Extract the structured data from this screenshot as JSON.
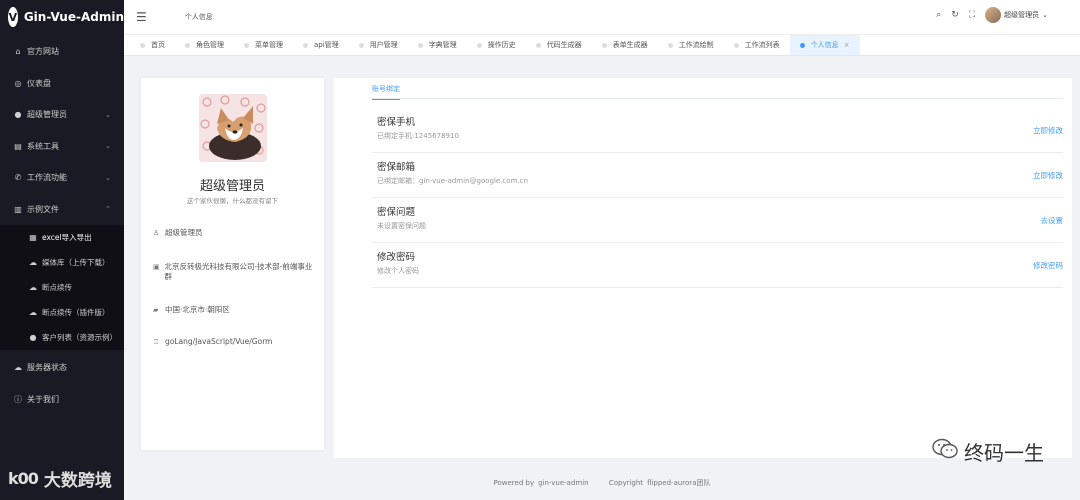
{
  "app": {
    "title": "Gin-Vue-Admin",
    "logo_letter": "V"
  },
  "sidebar": {
    "items": [
      {
        "label": "官方网站",
        "icon": "home-icon",
        "glyph": "⌂"
      },
      {
        "label": "仪表盘",
        "icon": "dashboard-icon",
        "glyph": "◎"
      },
      {
        "label": "超级管理员",
        "icon": "user-icon",
        "glyph": "●",
        "arrow": "⌄"
      },
      {
        "label": "系统工具",
        "icon": "toolbox-icon",
        "glyph": "▤",
        "arrow": "⌄"
      },
      {
        "label": "工作流功能",
        "icon": "phone-icon",
        "glyph": "✆",
        "arrow": "⌄"
      },
      {
        "label": "示例文件",
        "icon": "folder-icon",
        "glyph": "▥",
        "arrow": "⌃"
      }
    ],
    "sub_items": [
      {
        "label": "excel导入导出",
        "icon": "excel-icon",
        "glyph": "▦"
      },
      {
        "label": "媒体库（上传下载）",
        "icon": "upload-icon",
        "glyph": "☁"
      },
      {
        "label": "断点续传",
        "icon": "resume-upload-icon",
        "glyph": "☁"
      },
      {
        "label": "断点续传（插件版）",
        "icon": "plugin-upload-icon",
        "glyph": "☁"
      },
      {
        "label": "客户列表（资源示例）",
        "icon": "customer-icon",
        "glyph": "●"
      }
    ],
    "bottom_items": [
      {
        "label": "服务器状态",
        "icon": "cloud-icon",
        "glyph": "☁"
      },
      {
        "label": "关于我们",
        "icon": "info-icon",
        "glyph": "ⓘ"
      }
    ]
  },
  "header": {
    "menu_glyph": "☰",
    "breadcrumb": "个人信息",
    "search_glyph": "⌕",
    "refresh_glyph": "↻",
    "fullscreen_glyph": "⛶",
    "username": "超级管理员",
    "user_arrow": "⌄"
  },
  "tabs": [
    {
      "label": "首页"
    },
    {
      "label": "角色管理"
    },
    {
      "label": "菜单管理"
    },
    {
      "label": "api管理"
    },
    {
      "label": "用户管理"
    },
    {
      "label": "字典管理"
    },
    {
      "label": "操作历史"
    },
    {
      "label": "代码生成器"
    },
    {
      "label": "表单生成器"
    },
    {
      "label": "工作流绘制"
    },
    {
      "label": "工作流列表"
    },
    {
      "label": "个人信息",
      "active": true
    }
  ],
  "tab_close_glyph": "×",
  "profile": {
    "name": "超级管理员",
    "signature": "这个家伙很懒，什么都没有留下",
    "rows": [
      {
        "icon": "user-icon",
        "glyph": "♙",
        "text": "超级管理员"
      },
      {
        "icon": "company-icon",
        "glyph": "▣",
        "text": "北京反转极光科技有限公司-技术部-前端事业群"
      },
      {
        "icon": "location-icon",
        "glyph": "▰",
        "text": "中国·北京市·朝阳区"
      },
      {
        "icon": "medal-icon",
        "glyph": "♖",
        "text": "goLang/JavaScript/Vue/Gorm"
      }
    ]
  },
  "account": {
    "tab_label": "账号绑定",
    "items": [
      {
        "title": "密保手机",
        "desc": "已绑定手机:1245678910",
        "action": "立即修改"
      },
      {
        "title": "密保邮箱",
        "desc": "已绑定邮箱：gin-vue-admin@google.com.cn",
        "action": "立即修改"
      },
      {
        "title": "密保问题",
        "desc": "未设置密保问题",
        "action": "去设置"
      },
      {
        "title": "修改密码",
        "desc": "修改个人密码",
        "action": "修改密码"
      }
    ]
  },
  "footer": {
    "powered": "Powered by",
    "powered_name": "gin-vue-admin",
    "copyright": "Copyright",
    "copyright_name": "flipped-aurora团队"
  },
  "watermarks": {
    "left_mark": "k00",
    "left_text": "大数跨境",
    "right_icon": "wechat-icon",
    "right_text": "终码一生"
  },
  "colors": {
    "sidebar_bg": "#191a23",
    "accent": "#409eff",
    "page_bg": "#f0f2f5"
  }
}
